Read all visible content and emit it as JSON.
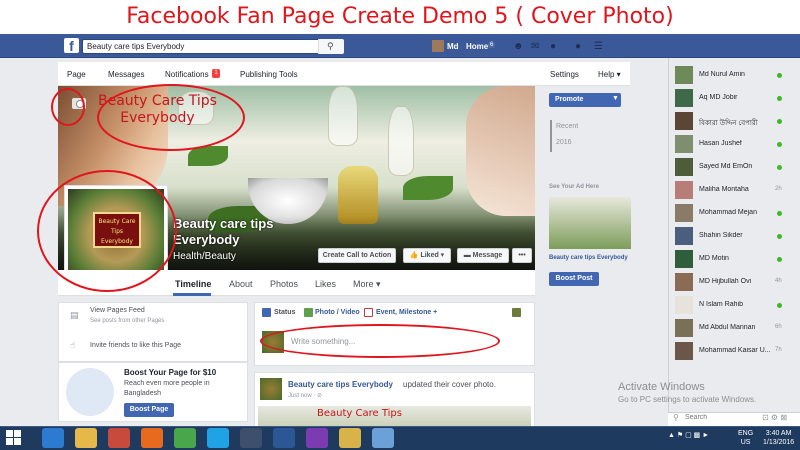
{
  "banner": {
    "title": "Facebook Fan Page Create Demo 5 ( Cover Photo)"
  },
  "bluebar": {
    "logo": "f",
    "search_value": "Beauty care tips Everybody",
    "user_name": "Md",
    "home_label": "Home",
    "home_count": "6"
  },
  "pagebar": {
    "page": "Page",
    "messages": "Messages",
    "notifications": "Notifications",
    "notif_count": "1",
    "publishing": "Publishing Tools",
    "settings": "Settings",
    "help": "Help ▾"
  },
  "cover": {
    "overlay_line1": "Beauty Care Tips",
    "overlay_line2": "Everybody",
    "page_name": "Beauty care tips Everybody",
    "category": "Health/Beauty",
    "profile_sign": "Beauty Care Tips Everybody"
  },
  "actions": {
    "call_to_action": "Create Call to Action",
    "liked": "👍 Liked ▾",
    "message": "▬ Message",
    "more": "•••"
  },
  "timeline_tabs": [
    "Timeline",
    "About",
    "Photos",
    "Likes",
    "More ▾"
  ],
  "left": {
    "feed_title": "View Pages Feed",
    "feed_sub": "See posts from other Pages",
    "invite": "Invite friends to like this Page",
    "boost_title": "Boost Your Page for $10",
    "boost_text": "Reach even more people in Bangladesh",
    "boost_btn": "Boost Page"
  },
  "composer": {
    "status": "Status",
    "photo_video": "Photo / Video",
    "event": "Event, Milestone +",
    "placeholder": "Write something..."
  },
  "post": {
    "author": "Beauty care tips Everybody",
    "action": "updated their cover photo.",
    "time": "Just now · ⊘",
    "image_text": "Beauty Care Tips"
  },
  "right": {
    "promote": "Promote",
    "recent": "Recent",
    "year": "2016",
    "ad_label": "See Your Ad Here",
    "ad_name": "Beauty care tips Everybody",
    "boost_post": "Boost Post"
  },
  "chat": {
    "contacts": [
      {
        "name": "Md Nurul Amin",
        "status": "online",
        "time": "",
        "color": "#6d8a58"
      },
      {
        "name": "Aq MD Jobir",
        "status": "online",
        "time": "",
        "color": "#3f6a4a"
      },
      {
        "name": "বিকারা উদ্দিন বেপারী",
        "status": "online",
        "time": "",
        "color": "#5b4636"
      },
      {
        "name": "Hasan Jushef",
        "status": "online",
        "time": "",
        "color": "#7e8e6f"
      },
      {
        "name": "Sayed Md EmOn",
        "status": "online",
        "time": "",
        "color": "#4f5c3a"
      },
      {
        "name": "Maliha Montaha",
        "status": "idle",
        "time": "2h",
        "color": "#b77e79"
      },
      {
        "name": "Mohammad Mejan",
        "status": "online",
        "time": "",
        "color": "#8a7a68"
      },
      {
        "name": "Shahin Sikder",
        "status": "online",
        "time": "",
        "color": "#4a5f7d"
      },
      {
        "name": "MD Motin",
        "status": "online",
        "time": "",
        "color": "#2f5f3a"
      },
      {
        "name": "MD Hijbullah Ovi",
        "status": "idle",
        "time": "4h",
        "color": "#8c6b55"
      },
      {
        "name": "N Islam Rahib",
        "status": "online",
        "time": "",
        "color": "#e7e3da"
      },
      {
        "name": "Md Abdul Mannan",
        "status": "idle",
        "time": "6h",
        "color": "#7a7058"
      },
      {
        "name": "Mohammad Kaisar U...",
        "status": "idle",
        "time": "7h",
        "color": "#6b5747"
      }
    ],
    "search_placeholder": "Search",
    "tools": "⊡ ⚙ ⊠"
  },
  "activate": {
    "line1": "Activate Windows",
    "line2": "Go to PC settings to activate Windows."
  },
  "taskbar": {
    "lang": "ENG",
    "region": "US",
    "time": "3:40 AM",
    "date": "1/13/2016",
    "icons": [
      "ie",
      "explorer",
      "security",
      "firefox",
      "chrome",
      "skype",
      "3g",
      "word",
      "media",
      "paint",
      "folder"
    ]
  }
}
